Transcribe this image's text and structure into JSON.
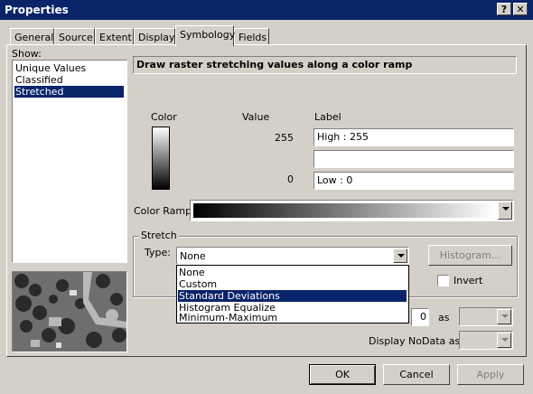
{
  "window": {
    "title": "Properties",
    "help_btn": "?",
    "close_btn": "✕"
  },
  "tabs": [
    {
      "label": "General"
    },
    {
      "label": "Source"
    },
    {
      "label": "Extent"
    },
    {
      "label": "Display"
    },
    {
      "label": "Symbology"
    },
    {
      "label": "Fields"
    }
  ],
  "show": {
    "label": "Show:",
    "items": [
      "Unique Values",
      "Classified",
      "Stretched"
    ],
    "selected": "Stretched"
  },
  "header": {
    "text": "Draw raster stretching values along a color ramp"
  },
  "columns": {
    "color": "Color",
    "value": "Value",
    "label": "Label"
  },
  "rows": [
    {
      "value": "255",
      "label": "High : 255"
    },
    {
      "value": "",
      "label": ""
    },
    {
      "value": "0",
      "label": "Low : 0"
    }
  ],
  "color_ramp": {
    "label": "Color Ramp:",
    "start_color": "#000000",
    "end_color": "#ffffff"
  },
  "stretch": {
    "group_label": "Stretch",
    "type_label": "Type:",
    "type_value": "None",
    "options": [
      "None",
      "Custom",
      "Standard Deviations",
      "Histogram Equalize",
      "Minimum-Maximum"
    ],
    "highlighted": "Standard Deviations",
    "histogram_btn": "Histogram...",
    "invert_label": "Invert"
  },
  "background": {
    "value": "0",
    "as_label": "as"
  },
  "nodata": {
    "label": "Display NoData as"
  },
  "buttons": {
    "ok": "OK",
    "cancel": "Cancel",
    "apply": "Apply"
  },
  "colors": {
    "titlebar": "#0a246a",
    "face": "#d4d0c8",
    "selection": "#0a246a"
  }
}
